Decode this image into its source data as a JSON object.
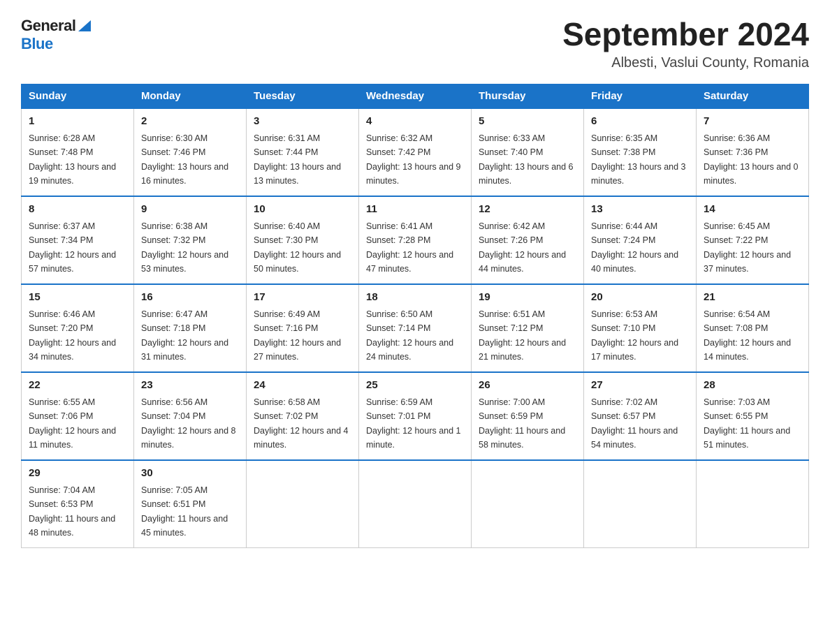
{
  "logo": {
    "text_general": "General",
    "text_blue": "Blue"
  },
  "title": {
    "month_year": "September 2024",
    "location": "Albesti, Vaslui County, Romania"
  },
  "days_of_week": [
    "Sunday",
    "Monday",
    "Tuesday",
    "Wednesday",
    "Thursday",
    "Friday",
    "Saturday"
  ],
  "weeks": [
    [
      {
        "day": "1",
        "sunrise": "Sunrise: 6:28 AM",
        "sunset": "Sunset: 7:48 PM",
        "daylight": "Daylight: 13 hours and 19 minutes."
      },
      {
        "day": "2",
        "sunrise": "Sunrise: 6:30 AM",
        "sunset": "Sunset: 7:46 PM",
        "daylight": "Daylight: 13 hours and 16 minutes."
      },
      {
        "day": "3",
        "sunrise": "Sunrise: 6:31 AM",
        "sunset": "Sunset: 7:44 PM",
        "daylight": "Daylight: 13 hours and 13 minutes."
      },
      {
        "day": "4",
        "sunrise": "Sunrise: 6:32 AM",
        "sunset": "Sunset: 7:42 PM",
        "daylight": "Daylight: 13 hours and 9 minutes."
      },
      {
        "day": "5",
        "sunrise": "Sunrise: 6:33 AM",
        "sunset": "Sunset: 7:40 PM",
        "daylight": "Daylight: 13 hours and 6 minutes."
      },
      {
        "day": "6",
        "sunrise": "Sunrise: 6:35 AM",
        "sunset": "Sunset: 7:38 PM",
        "daylight": "Daylight: 13 hours and 3 minutes."
      },
      {
        "day": "7",
        "sunrise": "Sunrise: 6:36 AM",
        "sunset": "Sunset: 7:36 PM",
        "daylight": "Daylight: 13 hours and 0 minutes."
      }
    ],
    [
      {
        "day": "8",
        "sunrise": "Sunrise: 6:37 AM",
        "sunset": "Sunset: 7:34 PM",
        "daylight": "Daylight: 12 hours and 57 minutes."
      },
      {
        "day": "9",
        "sunrise": "Sunrise: 6:38 AM",
        "sunset": "Sunset: 7:32 PM",
        "daylight": "Daylight: 12 hours and 53 minutes."
      },
      {
        "day": "10",
        "sunrise": "Sunrise: 6:40 AM",
        "sunset": "Sunset: 7:30 PM",
        "daylight": "Daylight: 12 hours and 50 minutes."
      },
      {
        "day": "11",
        "sunrise": "Sunrise: 6:41 AM",
        "sunset": "Sunset: 7:28 PM",
        "daylight": "Daylight: 12 hours and 47 minutes."
      },
      {
        "day": "12",
        "sunrise": "Sunrise: 6:42 AM",
        "sunset": "Sunset: 7:26 PM",
        "daylight": "Daylight: 12 hours and 44 minutes."
      },
      {
        "day": "13",
        "sunrise": "Sunrise: 6:44 AM",
        "sunset": "Sunset: 7:24 PM",
        "daylight": "Daylight: 12 hours and 40 minutes."
      },
      {
        "day": "14",
        "sunrise": "Sunrise: 6:45 AM",
        "sunset": "Sunset: 7:22 PM",
        "daylight": "Daylight: 12 hours and 37 minutes."
      }
    ],
    [
      {
        "day": "15",
        "sunrise": "Sunrise: 6:46 AM",
        "sunset": "Sunset: 7:20 PM",
        "daylight": "Daylight: 12 hours and 34 minutes."
      },
      {
        "day": "16",
        "sunrise": "Sunrise: 6:47 AM",
        "sunset": "Sunset: 7:18 PM",
        "daylight": "Daylight: 12 hours and 31 minutes."
      },
      {
        "day": "17",
        "sunrise": "Sunrise: 6:49 AM",
        "sunset": "Sunset: 7:16 PM",
        "daylight": "Daylight: 12 hours and 27 minutes."
      },
      {
        "day": "18",
        "sunrise": "Sunrise: 6:50 AM",
        "sunset": "Sunset: 7:14 PM",
        "daylight": "Daylight: 12 hours and 24 minutes."
      },
      {
        "day": "19",
        "sunrise": "Sunrise: 6:51 AM",
        "sunset": "Sunset: 7:12 PM",
        "daylight": "Daylight: 12 hours and 21 minutes."
      },
      {
        "day": "20",
        "sunrise": "Sunrise: 6:53 AM",
        "sunset": "Sunset: 7:10 PM",
        "daylight": "Daylight: 12 hours and 17 minutes."
      },
      {
        "day": "21",
        "sunrise": "Sunrise: 6:54 AM",
        "sunset": "Sunset: 7:08 PM",
        "daylight": "Daylight: 12 hours and 14 minutes."
      }
    ],
    [
      {
        "day": "22",
        "sunrise": "Sunrise: 6:55 AM",
        "sunset": "Sunset: 7:06 PM",
        "daylight": "Daylight: 12 hours and 11 minutes."
      },
      {
        "day": "23",
        "sunrise": "Sunrise: 6:56 AM",
        "sunset": "Sunset: 7:04 PM",
        "daylight": "Daylight: 12 hours and 8 minutes."
      },
      {
        "day": "24",
        "sunrise": "Sunrise: 6:58 AM",
        "sunset": "Sunset: 7:02 PM",
        "daylight": "Daylight: 12 hours and 4 minutes."
      },
      {
        "day": "25",
        "sunrise": "Sunrise: 6:59 AM",
        "sunset": "Sunset: 7:01 PM",
        "daylight": "Daylight: 12 hours and 1 minute."
      },
      {
        "day": "26",
        "sunrise": "Sunrise: 7:00 AM",
        "sunset": "Sunset: 6:59 PM",
        "daylight": "Daylight: 11 hours and 58 minutes."
      },
      {
        "day": "27",
        "sunrise": "Sunrise: 7:02 AM",
        "sunset": "Sunset: 6:57 PM",
        "daylight": "Daylight: 11 hours and 54 minutes."
      },
      {
        "day": "28",
        "sunrise": "Sunrise: 7:03 AM",
        "sunset": "Sunset: 6:55 PM",
        "daylight": "Daylight: 11 hours and 51 minutes."
      }
    ],
    [
      {
        "day": "29",
        "sunrise": "Sunrise: 7:04 AM",
        "sunset": "Sunset: 6:53 PM",
        "daylight": "Daylight: 11 hours and 48 minutes."
      },
      {
        "day": "30",
        "sunrise": "Sunrise: 7:05 AM",
        "sunset": "Sunset: 6:51 PM",
        "daylight": "Daylight: 11 hours and 45 minutes."
      },
      null,
      null,
      null,
      null,
      null
    ]
  ]
}
